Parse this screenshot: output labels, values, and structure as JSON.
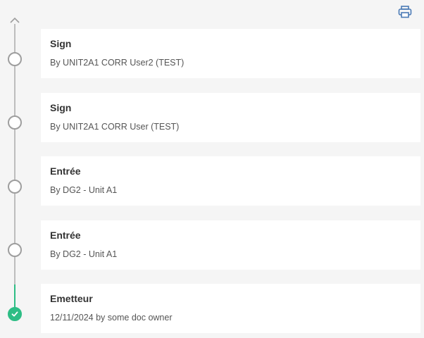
{
  "toolbar": {
    "print_icon": "printer-icon"
  },
  "timeline": {
    "steps": [
      {
        "title": "Sign",
        "subtitle": "By UNIT2A1 CORR User2 (TEST)",
        "status": "pending"
      },
      {
        "title": "Sign",
        "subtitle": "By UNIT2A1 CORR User (TEST)",
        "status": "pending"
      },
      {
        "title": "Entrée",
        "subtitle": "By DG2 - Unit A1",
        "status": "pending"
      },
      {
        "title": "Entrée",
        "subtitle": "By DG2 - Unit A1",
        "status": "pending"
      },
      {
        "title": "Emetteur",
        "subtitle": "12/11/2024 by some doc owner",
        "status": "done"
      }
    ]
  },
  "colors": {
    "accent_done": "#2ebd85",
    "print_icon": "#4a7ab5",
    "line": "#bdbdbd"
  }
}
